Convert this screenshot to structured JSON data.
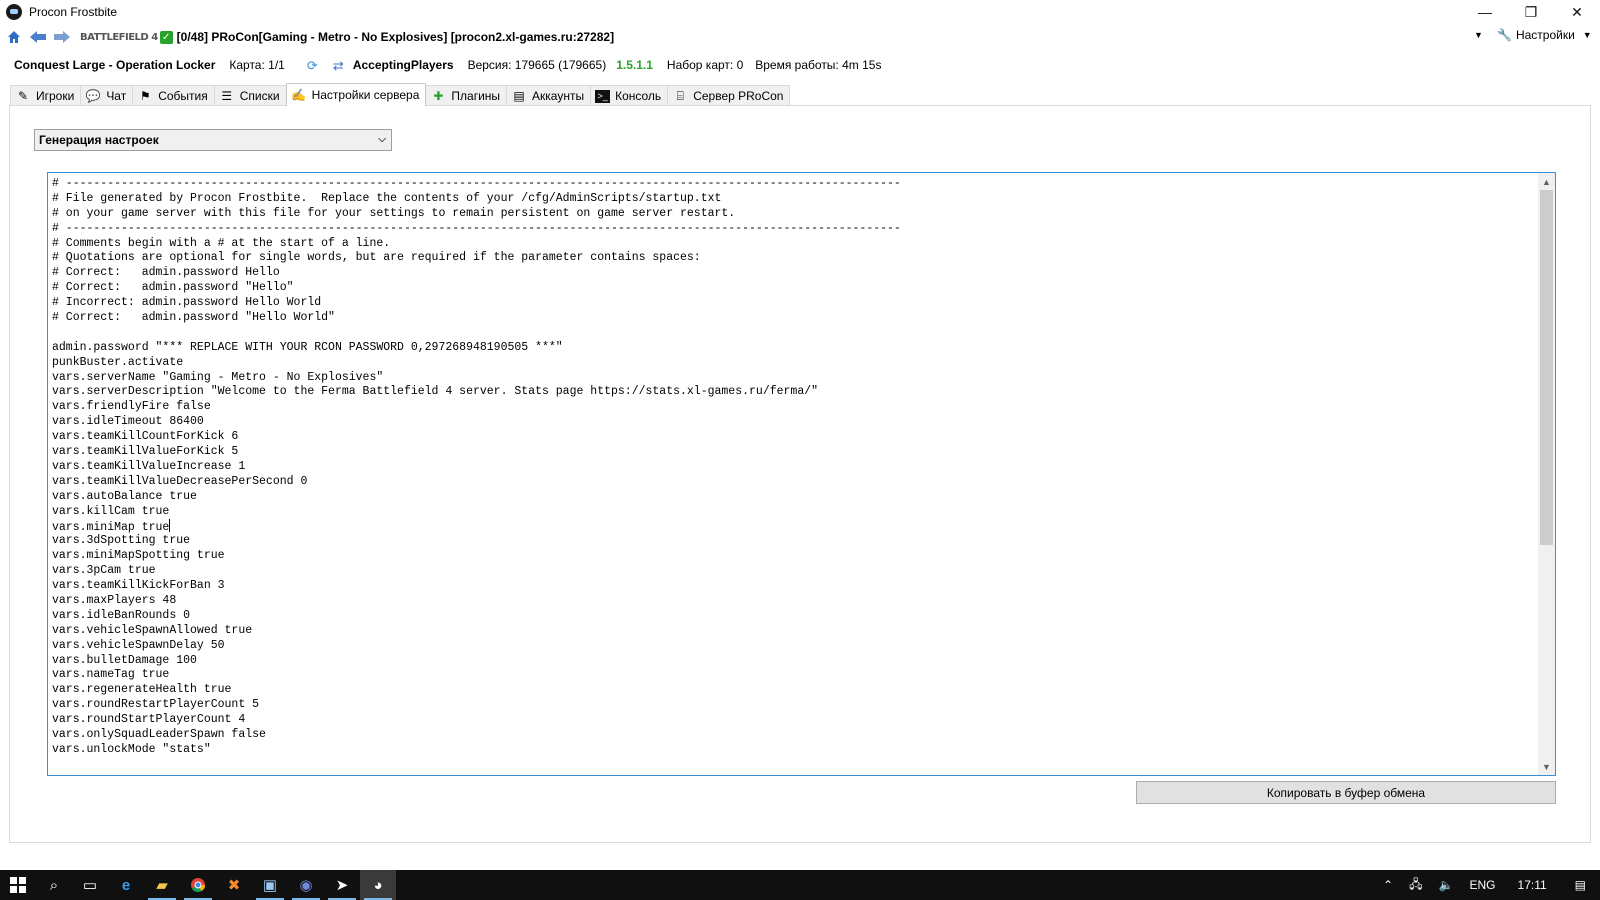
{
  "window": {
    "title": "Procon Frostbite",
    "controls": {
      "minimize": "—",
      "maximize": "❐",
      "close": "✕"
    }
  },
  "toolbar": {
    "game_logo": "BATTLEFIELD 4",
    "connection_title": "[0/48] PRoCon[Gaming - Metro - No Explosives] [procon2.xl-games.ru:27282]",
    "settings_label": "Настройки"
  },
  "status": {
    "map": "Conquest Large - Operation Locker",
    "round": "Карта: 1/1",
    "state": "AcceptingPlayers",
    "version": "Версия: 179665 (179665)",
    "procon_version": "1.5.1.1",
    "mapset": "Набор карт: 0",
    "uptime": "Время работы: 4m 15s"
  },
  "tabs": [
    {
      "label": "Игроки",
      "icon": "players-icon"
    },
    {
      "label": "Чат",
      "icon": "chat-icon"
    },
    {
      "label": "События",
      "icon": "events-icon"
    },
    {
      "label": "Списки",
      "icon": "lists-icon"
    },
    {
      "label": "Настройки сервера",
      "icon": "server-settings-icon",
      "active": true
    },
    {
      "label": "Плагины",
      "icon": "plugins-icon"
    },
    {
      "label": "Аккаунты",
      "icon": "accounts-icon"
    },
    {
      "label": "Консоль",
      "icon": "console-icon"
    },
    {
      "label": "Сервер PRoCon",
      "icon": "procon-server-icon"
    }
  ],
  "settings": {
    "selected": "Генерация настроек",
    "copy_button": "Копировать в буфер обмена",
    "lines": [
      "# -------------------------------------------------------------------------------------------------------------------------",
      "# File generated by Procon Frostbite.  Replace the contents of your /cfg/AdminScripts/startup.txt",
      "# on your game server with this file for your settings to remain persistent on game server restart.",
      "# -------------------------------------------------------------------------------------------------------------------------",
      "# Comments begin with a # at the start of a line.",
      "# Quotations are optional for single words, but are required if the parameter contains spaces:",
      "# Correct:   admin.password Hello",
      "# Correct:   admin.password \"Hello\"",
      "# Incorrect: admin.password Hello World",
      "# Correct:   admin.password \"Hello World\"",
      "",
      "admin.password \"*** REPLACE WITH YOUR RCON PASSWORD 0,297268948190505 ***\"",
      "punkBuster.activate",
      "vars.serverName \"Gaming - Metro - No Explosives\"",
      "vars.serverDescription \"Welcome to the Ferma Battlefield 4 server. Stats page https://stats.xl-games.ru/ferma/\"",
      "vars.friendlyFire false",
      "vars.idleTimeout 86400",
      "vars.teamKillCountForKick 6",
      "vars.teamKillValueForKick 5",
      "vars.teamKillValueIncrease 1",
      "vars.teamKillValueDecreasePerSecond 0",
      "vars.autoBalance true",
      "vars.killCam true",
      "vars.miniMap true",
      "vars.3dSpotting true",
      "vars.miniMapSpotting true",
      "vars.3pCam true",
      "vars.teamKillKickForBan 3",
      "vars.maxPlayers 48",
      "vars.idleBanRounds 0",
      "vars.vehicleSpawnAllowed true",
      "vars.vehicleSpawnDelay 50",
      "vars.bulletDamage 100",
      "vars.nameTag true",
      "vars.regenerateHealth true",
      "vars.roundRestartPlayerCount 5",
      "vars.roundStartPlayerCount 4",
      "vars.onlySquadLeaderSpawn false",
      "vars.unlockMode \"stats\""
    ]
  },
  "taskbar": {
    "lang": "ENG",
    "time": "17:11"
  },
  "colors": {
    "accent": "#3c8fd8",
    "procon_version": "#2aa32a",
    "taskbar": "#101010"
  }
}
